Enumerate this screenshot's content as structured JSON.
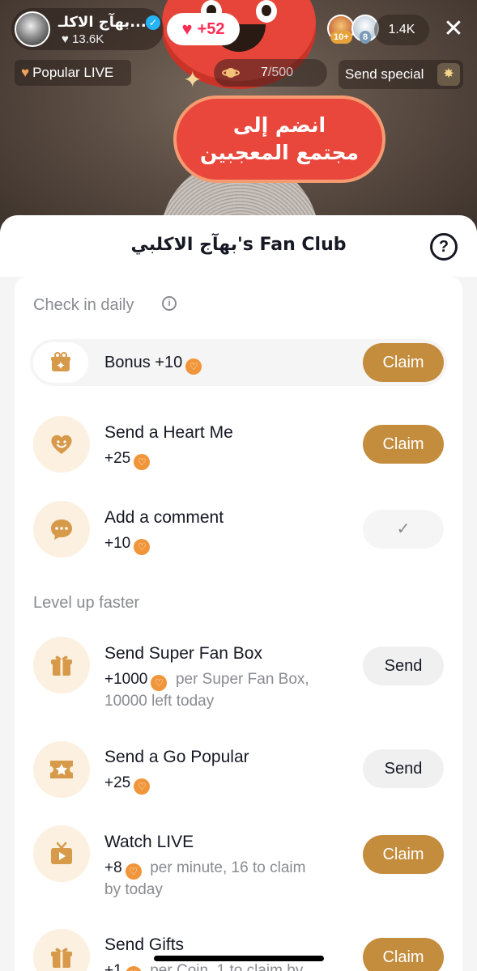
{
  "live": {
    "banner_line1": "انضم إلى",
    "banner_line2": "مجتمع المعجبين"
  },
  "host": {
    "name": "بهآج الاكلـ...",
    "likes": "♥ 13.6K"
  },
  "like_button": {
    "value": "+52"
  },
  "viewers": {
    "badge1": "10+",
    "badge2": "8",
    "count": "1.4K"
  },
  "popular": {
    "label": "Popular LIVE"
  },
  "progress": {
    "current": "7",
    "total": "/500"
  },
  "special": {
    "label": "Send special"
  },
  "sheet": {
    "title": "بهآج الاكلبي's Fan Club"
  },
  "sections": {
    "checkin_title": "Check in daily",
    "levelup_title": "Level up faster"
  },
  "tasks": {
    "bonus": {
      "title": "Bonus +10",
      "button": "Claim"
    },
    "heart": {
      "title": "Send a Heart Me",
      "points": "+25",
      "button": "Claim"
    },
    "comment": {
      "title": "Add a comment",
      "points": "+10",
      "button": "✓"
    },
    "superfan": {
      "title": "Send Super Fan Box",
      "points": "+1000",
      "note": "per Super Fan Box,",
      "note2": "10000 left today",
      "button": "Send"
    },
    "popular": {
      "title": "Send a Go Popular",
      "points": "+25",
      "button": "Send"
    },
    "watch": {
      "title": "Watch LIVE",
      "points": "+8",
      "note": "per minute, 16 to claim",
      "note2": "by today",
      "button": "Claim"
    },
    "gifts": {
      "title": "Send Gifts",
      "points": "+1",
      "note": "per Coin, 1 to claim by",
      "button": "Claim"
    }
  },
  "colors": {
    "accent": "#c48c3d",
    "coin": "#f0953a",
    "icon_bg": "#fcf0e0",
    "like_red": "#fe2c55"
  }
}
